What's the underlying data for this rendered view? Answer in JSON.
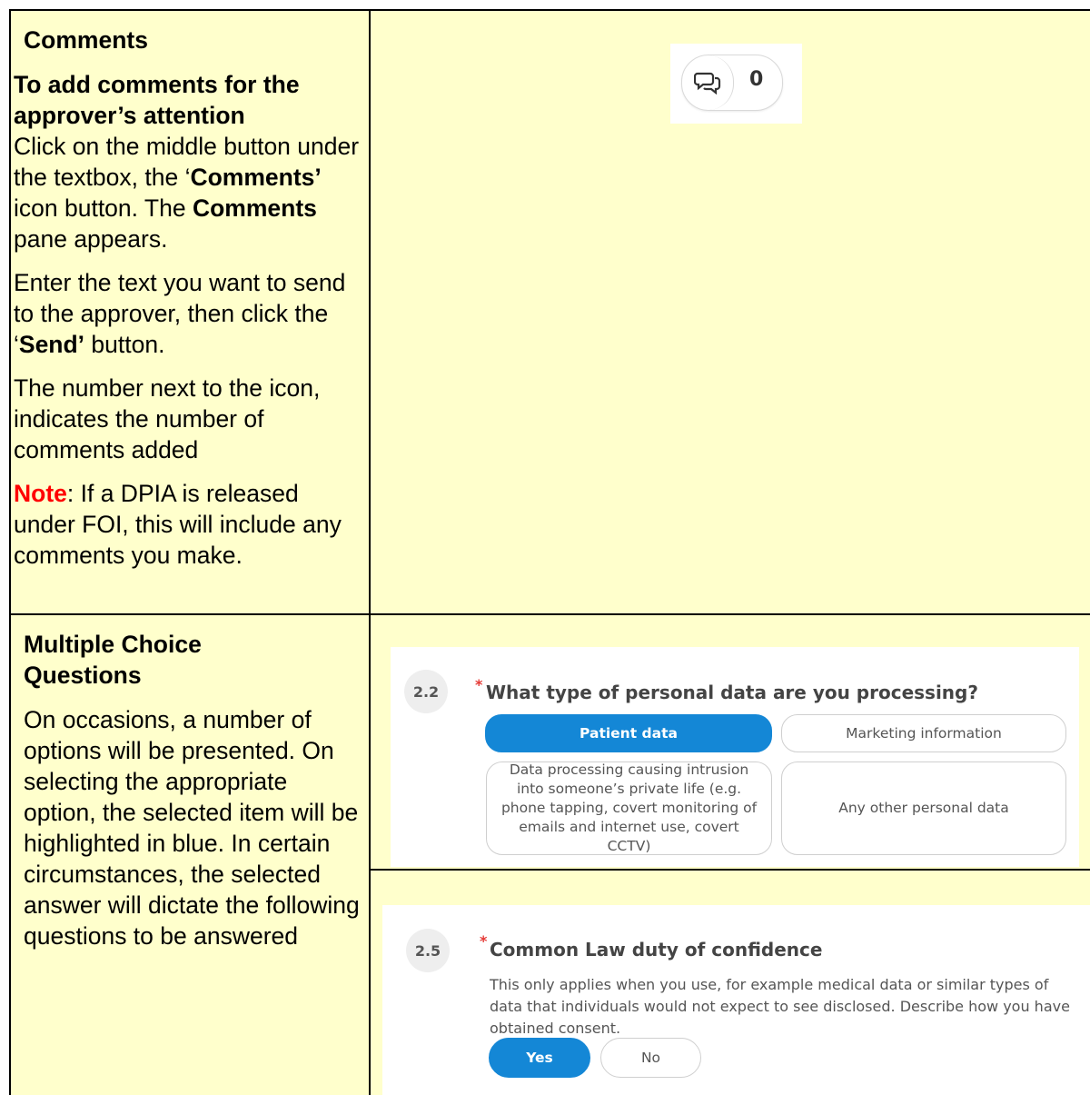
{
  "comments_row": {
    "heading": "Comments",
    "subheading": "To add comments for the approver’s attention",
    "p1_pre": "Click on the middle button under the textbox, the ‘",
    "p1_bold1": "Comments’",
    "p1_mid": " icon button. The ",
    "p1_bold2": "Comments",
    "p1_post": " pane appears.",
    "p2_pre": "Enter the text you want to send to the approver, then click the ‘",
    "p2_bold": "Send’",
    "p2_post": " button.",
    "p3": "The number next to the icon, indicates the number of comments added",
    "note_label": "Note",
    "note_text": ": If a DPIA is released under FOI, this will include any comments you make.",
    "widget": {
      "icon": "comments-icon",
      "count": "0"
    }
  },
  "mcq_row": {
    "heading": "Multiple Choice Questions",
    "text": "On occasions, a number of options will be presented. On selecting the appropriate option, the selected item will be highlighted in blue. In certain circumstances, the selected answer will dictate the following questions to be answered"
  },
  "q22": {
    "number": "2.2",
    "required_mark": "*",
    "title": "What type of personal data are you processing?",
    "options": [
      "Patient data",
      "Marketing information",
      "Data processing causing intrusion into someone’s private life (e.g. phone tapping, covert monitoring of emails and internet use, covert CCTV)",
      "Any other personal data"
    ],
    "selected_index": 0
  },
  "q25": {
    "number": "2.5",
    "required_mark": "*",
    "title": "Common Law duty of confidence",
    "description": "This only applies when you use, for example medical data or similar types of data that individuals would not expect to see disclosed. Describe how you have obtained consent.",
    "options": [
      "Yes",
      "No"
    ],
    "selected_index": 0
  },
  "colors": {
    "cell_bg": "#ffffcc",
    "selected_blue": "#1487d6",
    "note_red": "#ff0000"
  }
}
